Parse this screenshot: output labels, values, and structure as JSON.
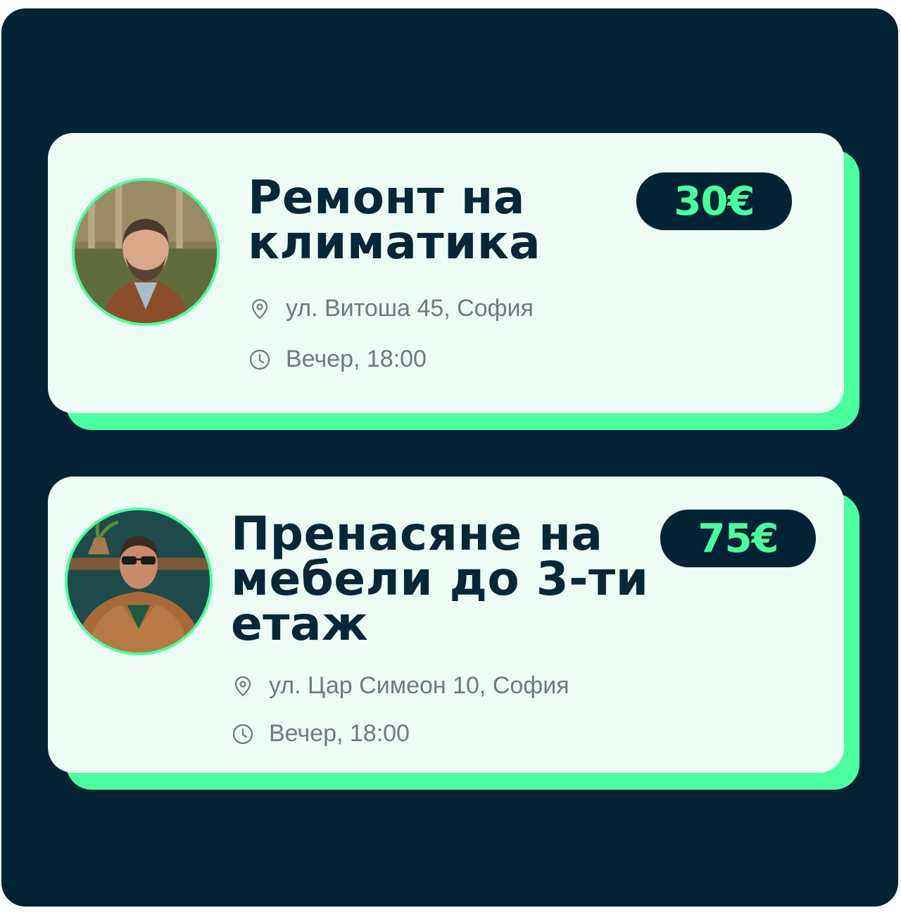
{
  "cards": [
    {
      "title": "Ремонт на\nклиматика",
      "price": "30€",
      "address": "ул. Витоша 45, София",
      "time": "Вечер, 18:00",
      "avatar_icon": "person-avatar"
    },
    {
      "title": "Пренасяне на\nмебели до 3-ти\nетаж",
      "price": "75€",
      "address": "ул. Цар Симеон 10, София",
      "time": "Вечер, 18:00",
      "avatar_icon": "person-avatar"
    }
  ],
  "colors": {
    "background": "#022336",
    "accent": "#4cff9e",
    "card": "#edfcf5",
    "title": "#062738",
    "meta_text": "#6d7a82"
  }
}
